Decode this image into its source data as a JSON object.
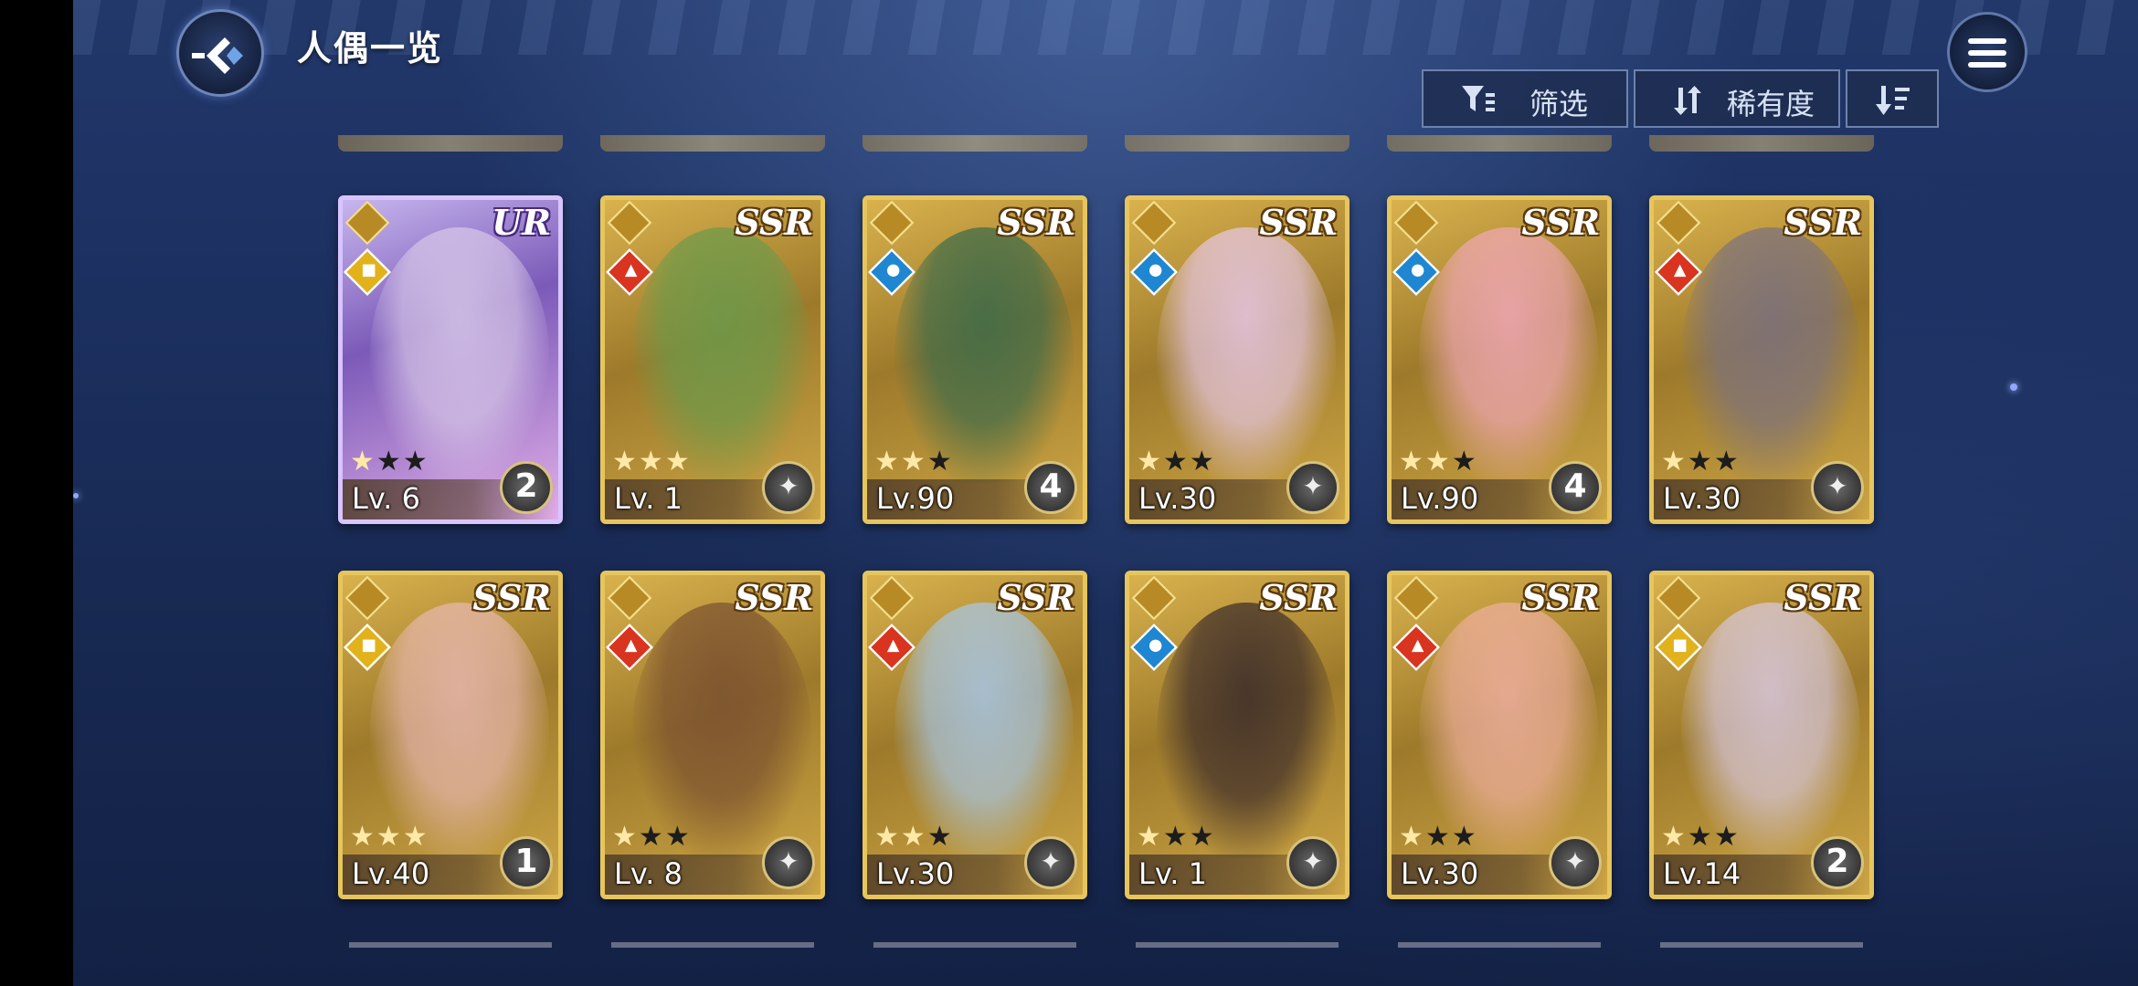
{
  "header": {
    "title": "人偶一览",
    "filter_label": "筛选",
    "sort_label": "稀有度"
  },
  "icons": {
    "back": "back-arrow-icon",
    "menu": "hamburger-menu-icon",
    "filter": "filter-icon",
    "sort": "sort-arrows-icon",
    "order": "sort-descending-icon"
  },
  "colors": {
    "background": "#1c3060",
    "card_border_gold": "#e7c55d",
    "card_border_ur": "#d8c4ff",
    "fire": "#d9341f",
    "water": "#1f86d1",
    "light": "#e2b21c"
  },
  "cards": [
    {
      "rarity": "UR",
      "level": "Lv. 6",
      "stars": 1,
      "badge": "2",
      "attr": "light",
      "art": "#d8c8e8"
    },
    {
      "rarity": "SSR",
      "level": "Lv. 1",
      "stars": 3,
      "badge": "emblem",
      "attr": "fire",
      "art": "#6a9a4a"
    },
    {
      "rarity": "SSR",
      "level": "Lv.90",
      "stars": 2,
      "badge": "4",
      "attr": "water",
      "art": "#3a6a4a"
    },
    {
      "rarity": "SSR",
      "level": "Lv.30",
      "stars": 1,
      "badge": "emblem",
      "attr": "water",
      "art": "#e8c8e8"
    },
    {
      "rarity": "SSR",
      "level": "Lv.90",
      "stars": 2,
      "badge": "4",
      "attr": "water",
      "art": "#f2a8b8"
    },
    {
      "rarity": "SSR",
      "level": "Lv.30",
      "stars": 1,
      "badge": "emblem",
      "attr": "fire",
      "art": "#7a7080"
    },
    {
      "rarity": "SSR",
      "level": "Lv.40",
      "stars": 3,
      "badge": "1",
      "attr": "light",
      "art": "#e8b8b0"
    },
    {
      "rarity": "SSR",
      "level": "Lv. 8",
      "stars": 1,
      "badge": "emblem",
      "attr": "fire",
      "art": "#7a5030"
    },
    {
      "rarity": "SSR",
      "level": "Lv.30",
      "stars": 2,
      "badge": "emblem",
      "attr": "fire",
      "art": "#a8c8e8"
    },
    {
      "rarity": "SSR",
      "level": "Lv. 1",
      "stars": 1,
      "badge": "emblem",
      "attr": "water",
      "art": "#3a2a2a"
    },
    {
      "rarity": "SSR",
      "level": "Lv.30",
      "stars": 1,
      "badge": "emblem",
      "attr": "fire",
      "art": "#f0b0a0"
    },
    {
      "rarity": "SSR",
      "level": "Lv.14",
      "stars": 1,
      "badge": "2",
      "attr": "light",
      "art": "#d8c8e0"
    }
  ]
}
